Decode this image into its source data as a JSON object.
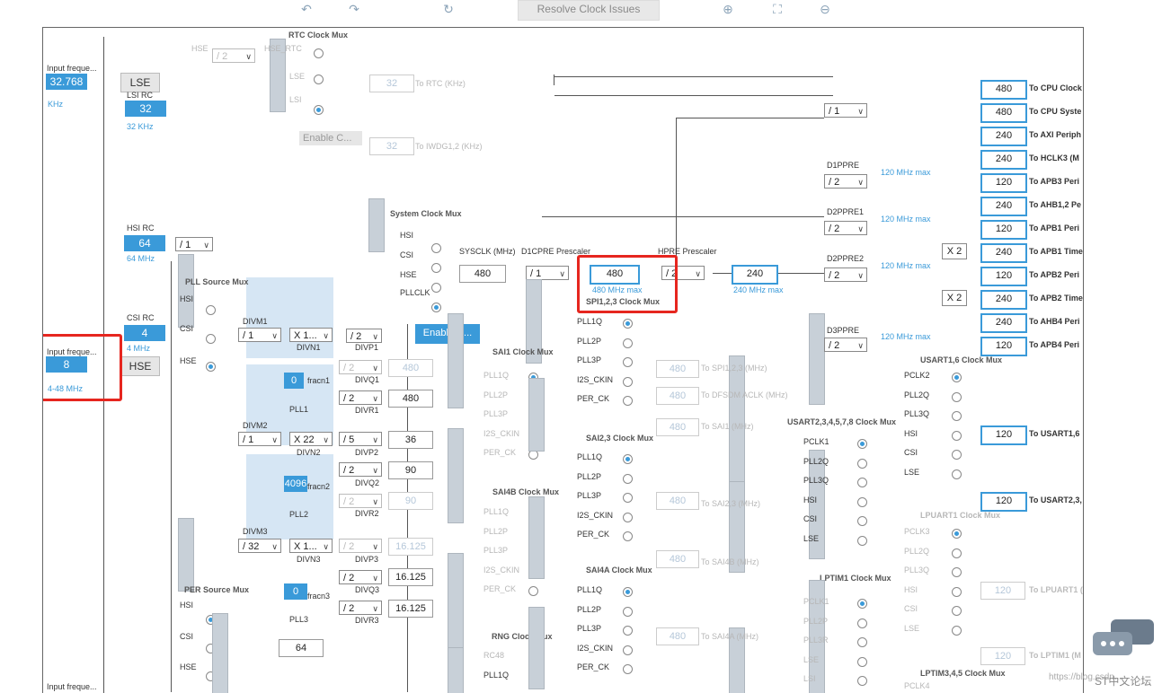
{
  "toolbar": {
    "resolve_label": "Resolve Clock Issues",
    "icons": [
      "undo-icon",
      "redo-icon",
      "refresh-icon",
      "zoom-in-icon",
      "fit-icon",
      "zoom-out-icon"
    ]
  },
  "left": {
    "input_freq_label": "Input freque...",
    "lse_value": "32.768",
    "lse_unit": "KHz",
    "lse_button": "LSE",
    "lsi_rc_label": "LSI RC",
    "lsi_value": "32",
    "lsi_unit": "32 KHz",
    "hsi_rc_label": "HSI RC",
    "hsi_value": "64",
    "hsi_unit": "64 MHz",
    "hsi_div": "/ 1",
    "csi_rc_label": "CSI RC",
    "csi_value": "4",
    "csi_unit": "4 MHz",
    "hse_input_label": "Input freque...",
    "hse_value": "8",
    "hse_range": "4-48 MHz",
    "hse_button": "HSE",
    "bottom_input_label": "Input freque..."
  },
  "rtc": {
    "title": "RTC Clock Mux",
    "hse_label": "HSE",
    "hse_div": "/ 2",
    "hse_rtc": "HSE_RTC",
    "lse": "LSE",
    "lsi": "LSI",
    "rtc_value": "32",
    "rtc_out": "To RTC (KHz)",
    "iwdg_value": "32",
    "iwdg_out": "To IWDG1,2 (KHz)",
    "enable_css": "Enable C..."
  },
  "sysmux": {
    "title": "System Clock Mux",
    "inputs": [
      "HSI",
      "CSI",
      "HSE",
      "PLLCLK"
    ],
    "sysclk_label": "SYSCLK (MHz)",
    "sysclk_value": "480",
    "d1cpre_label": "D1CPRE Prescaler",
    "d1cpre_div": "/ 1",
    "hpre_value": "480",
    "hpre_max": "480 MHz max",
    "hpre_label": "HPRE Prescaler",
    "hpre_div": "/ 2",
    "hclk_value": "240",
    "hclk_max": "240 MHz max",
    "enable_css": "Enable C..."
  },
  "pll": {
    "source_title": "PLL Source Mux",
    "source_inputs": [
      "HSI",
      "CSI",
      "HSE"
    ],
    "divm1_label": "DIVM1",
    "divm1": "/ 1",
    "divn1": "X 1...",
    "divn1_label": "DIVN1",
    "divp1": "/ 2",
    "divp1_label": "DIVP1",
    "divq1": "/ 2",
    "divq1_label": "DIVQ1",
    "divq1_value": "480",
    "divr1": "/ 2",
    "divr1_label": "DIVR1",
    "divr1_value": "480",
    "fracn1": "0",
    "fracn1_label": "fracn1",
    "pll1_label": "PLL1",
    "divm2_label": "DIVM2",
    "divm2": "/ 1",
    "divn2": "X 22",
    "divn2_label": "DIVN2",
    "divp2": "/ 5",
    "divp2_label": "DIVP2",
    "divp2_value": "36",
    "divq2": "/ 2",
    "divq2_label": "DIVQ2",
    "divq2_value": "90",
    "divr2": "/ 2",
    "divr2_label": "DIVR2",
    "divr2_value": "90",
    "fracn2": "4096",
    "fracn2_label": "fracn2",
    "pll2_label": "PLL2",
    "divm3_label": "DIVM3",
    "divm3": "/ 32",
    "divn3": "X 1...",
    "divn3_label": "DIVN3",
    "divp3": "/ 2",
    "divp3_label": "DIVP3",
    "divp3_value": "16.125",
    "divq3": "/ 2",
    "divq3_label": "DIVQ3",
    "divq3_value": "16.125",
    "divr3": "/ 2",
    "divr3_label": "DIVR3",
    "divr3_value": "16.125",
    "fracn3": "0",
    "fracn3_label": "fracn3",
    "pll3_label": "PLL3",
    "divp1_value": "480"
  },
  "per": {
    "title": "PER Source Mux",
    "inputs": [
      "HSI",
      "CSI",
      "HSE"
    ],
    "value": "64"
  },
  "muxes": {
    "sai1_title": "SAI1 Clock Mux",
    "sai1_inputs": [
      "PLL1Q",
      "PLL2P",
      "PLL3P",
      "I2S_CKIN",
      "PER_CK"
    ],
    "sai23_title": "SAI2,3 Clock Mux",
    "sai4b_title": "SAI4B Clock Mux",
    "sai4b_inputs": [
      "PLL1Q",
      "PLL2P",
      "PLL3P",
      "I2S_CKIN",
      "PER_CK"
    ],
    "rng_title": "RNG Clock Mux",
    "rng_inputs": [
      "RC48",
      "PLL1Q"
    ],
    "spi_title": "SPI1,2,3 Clock Mux",
    "spi_inputs": [
      "PLL1Q",
      "PLL2P",
      "PLL3P",
      "I2S_CKIN",
      "PER_CK"
    ],
    "sai23_inputs": [
      "PLL1Q",
      "PLL2P",
      "PLL3P",
      "I2S_CKIN",
      "PER_CK"
    ],
    "sai4a_title": "SAI4A Clock Mux",
    "sai4a_inputs": [
      "PLL1Q",
      "PLL2P",
      "PLL3P",
      "I2S_CKIN",
      "PER_CK"
    ]
  },
  "outputs_mid": {
    "spi_value": "480",
    "spi_label": "To SPI1,2,3 (MHz)",
    "dfsdm_value": "480",
    "dfsdm_label": "To DFSDM ACLK (MHz)",
    "sai1_value": "480",
    "sai1_label": "To SAI1 (MHz)",
    "sai23_value": "480",
    "sai23_label": "To SAI2,3 (MHz)",
    "sai4b_value": "480",
    "sai4b_label": "To SAI4B (MHz)",
    "sai4a_value": "480",
    "sai4a_label": "To SAI4A (MHz)"
  },
  "prescalers": {
    "cpu_div": "/ 1",
    "d1ppre_label": "D1PPRE",
    "d1ppre_div": "/ 2",
    "d1ppre_max": "120 MHz max",
    "d2ppre1_label": "D2PPRE1",
    "d2ppre1_div": "/ 2",
    "d2ppre1_max": "120 MHz max",
    "d2ppre2_label": "D2PPRE2",
    "d2ppre2_div": "/ 2",
    "d2ppre2_max": "120 MHz max",
    "d3ppre_label": "D3PPRE",
    "d3ppre_div": "/ 2",
    "d3ppre_max": "120 MHz max",
    "x2a": "X 2",
    "x2b": "X 2"
  },
  "right_outputs": [
    {
      "value": "480",
      "label": "To CPU Clock"
    },
    {
      "value": "480",
      "label": "To CPU Syste"
    },
    {
      "value": "240",
      "label": "To AXI Periph"
    },
    {
      "value": "240",
      "label": "To HCLK3 (M"
    },
    {
      "value": "120",
      "label": "To APB3 Peri"
    },
    {
      "value": "240",
      "label": "To AHB1,2 Pe"
    },
    {
      "value": "120",
      "label": "To APB1 Peri"
    },
    {
      "value": "240",
      "label": "To APB1 Time"
    },
    {
      "value": "120",
      "label": "To APB2 Peri"
    },
    {
      "value": "240",
      "label": "To APB2 Time"
    },
    {
      "value": "240",
      "label": "To AHB4 Peri"
    },
    {
      "value": "120",
      "label": "To APB4 Peri"
    }
  ],
  "usart16": {
    "title": "USART1,6 Clock Mux",
    "inputs": [
      "PCLK2",
      "PLL2Q",
      "PLL3Q",
      "HSI",
      "CSI",
      "LSE"
    ],
    "value": "120",
    "out": "To USART1,6"
  },
  "usart2": {
    "title": "USART2,3,4,5,7,8 Clock Mux",
    "inputs": [
      "PCLK1",
      "PLL2Q",
      "PLL3Q",
      "HSI",
      "CSI",
      "LSE"
    ],
    "value": "120",
    "out": "To USART2,3,"
  },
  "lpuart": {
    "title": "LPUART1 Clock Mux",
    "inputs": [
      "PCLK3",
      "PLL2Q",
      "PLL3Q",
      "HSI",
      "CSI",
      "LSE"
    ],
    "value": "120",
    "out": "To LPUART1 ("
  },
  "lptim1": {
    "title": "LPTIM1 Clock Mux",
    "inputs": [
      "PCLK1",
      "PLL2P",
      "PLL3R",
      "LSE",
      "LSI"
    ],
    "value": "120",
    "out": "To LPTIM1 (M"
  },
  "lptim345": {
    "title": "LPTIM3,4,5 Clock Mux",
    "inputs": [
      "PCLK4"
    ]
  },
  "watermark": {
    "url": "https://blog.csdn...",
    "brand": "ST中文论坛"
  }
}
